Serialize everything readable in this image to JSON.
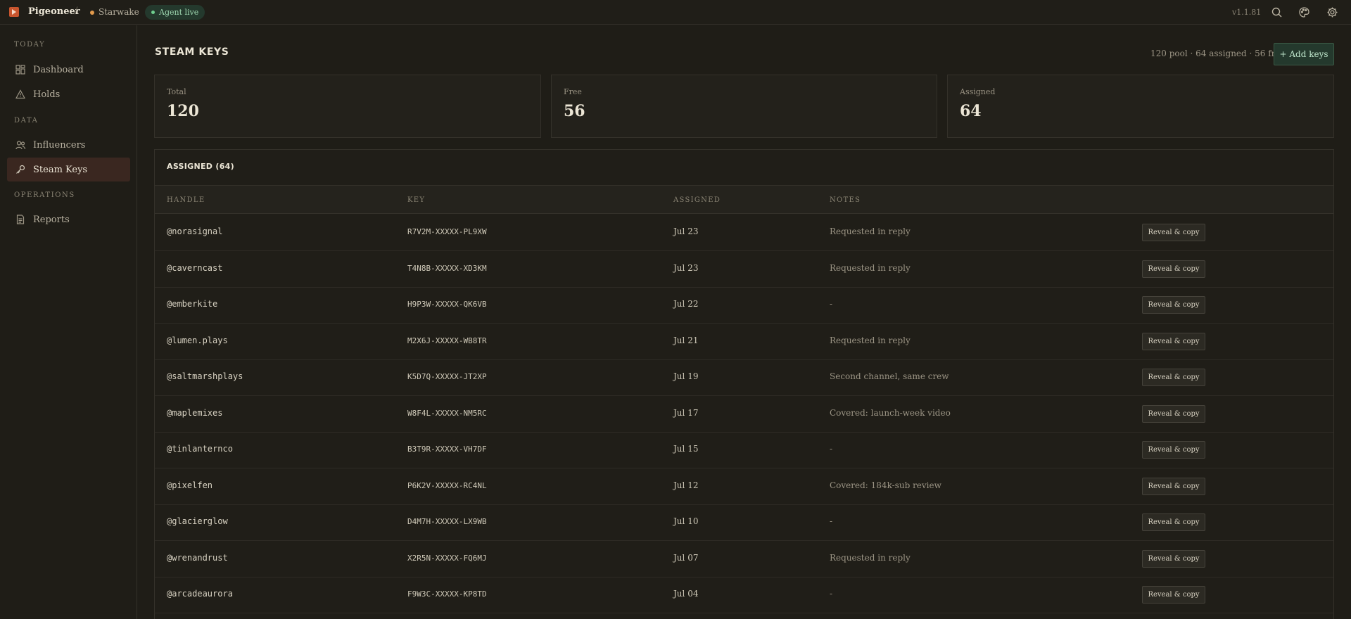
{
  "app": {
    "brand": "Pigeoneer",
    "separator": "/",
    "project": "Starwake",
    "agent_status": "Agent live",
    "version": "v1.1.81",
    "colors": {
      "accent": "#c8552e",
      "agent_green": "#6fd08f",
      "project_dot": "#e29a4c",
      "active_nav": "#3a2720"
    }
  },
  "topbar_icons": [
    "search-icon",
    "palette-icon",
    "gear-icon"
  ],
  "sidebar": {
    "sections": [
      {
        "title": "TODAY",
        "items": [
          {
            "label": "Dashboard",
            "icon": "grid-icon",
            "active": false
          },
          {
            "label": "Holds",
            "icon": "warning-icon",
            "active": false
          }
        ]
      },
      {
        "title": "DATA",
        "items": [
          {
            "label": "Influencers",
            "icon": "users-icon",
            "active": false
          },
          {
            "label": "Steam Keys",
            "icon": "key-icon",
            "active": true
          }
        ]
      },
      {
        "title": "OPERATIONS",
        "items": [
          {
            "label": "Reports",
            "icon": "document-icon",
            "active": false
          }
        ]
      }
    ]
  },
  "page": {
    "title": "STEAM KEYS",
    "summary": "120 pool · 64 assigned · 56 free",
    "add_button": "+ Add keys"
  },
  "stats": [
    {
      "label": "Total",
      "value": "120"
    },
    {
      "label": "Free",
      "value": "56"
    },
    {
      "label": "Assigned",
      "value": "64"
    }
  ],
  "table": {
    "title": "ASSIGNED (64)",
    "columns": [
      "HANDLE",
      "KEY",
      "ASSIGNED",
      "NOTES"
    ],
    "action_label": "Reveal & copy",
    "rows": [
      {
        "handle": "@norasignal",
        "key": "R7V2M-XXXXX-PL9XW",
        "assigned": "Jul 23",
        "notes": "Requested in reply"
      },
      {
        "handle": "@caverncast",
        "key": "T4N8B-XXXXX-XD3KM",
        "assigned": "Jul 23",
        "notes": "Requested in reply"
      },
      {
        "handle": "@emberkite",
        "key": "H9P3W-XXXXX-QK6VB",
        "assigned": "Jul 22",
        "notes": "-"
      },
      {
        "handle": "@lumen.plays",
        "key": "M2X6J-XXXXX-WB8TR",
        "assigned": "Jul 21",
        "notes": "Requested in reply"
      },
      {
        "handle": "@saltmarshplays",
        "key": "K5D7Q-XXXXX-JT2XP",
        "assigned": "Jul 19",
        "notes": "Second channel, same crew"
      },
      {
        "handle": "@maplemixes",
        "key": "W8F4L-XXXXX-NM5RC",
        "assigned": "Jul 17",
        "notes": "Covered: launch-week video"
      },
      {
        "handle": "@tinlanternco",
        "key": "B3T9R-XXXXX-VH7DF",
        "assigned": "Jul 15",
        "notes": "-"
      },
      {
        "handle": "@pixelfen",
        "key": "P6K2V-XXXXX-RC4NL",
        "assigned": "Jul 12",
        "notes": "Covered: 184k-sub review"
      },
      {
        "handle": "@glacierglow",
        "key": "D4M7H-XXXXX-LX9WB",
        "assigned": "Jul 10",
        "notes": "-"
      },
      {
        "handle": "@wrenandrust",
        "key": "X2R5N-XXXXX-FQ6MJ",
        "assigned": "Jul 07",
        "notes": "Requested in reply"
      },
      {
        "handle": "@arcadeaurora",
        "key": "F9W3C-XXXXX-KP8TD",
        "assigned": "Jul 04",
        "notes": "-"
      }
    ]
  }
}
